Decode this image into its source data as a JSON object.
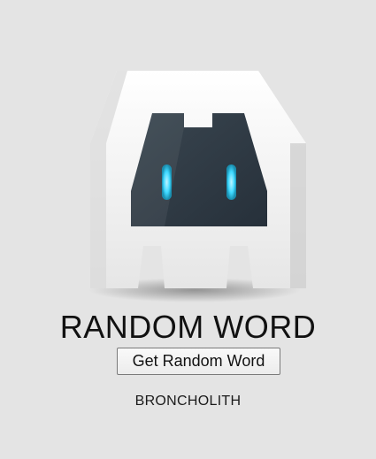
{
  "logo": {
    "icon": "cordova-robot-logo",
    "body_color": "#f2f2f2",
    "shade_color": "#d6d6d6",
    "screen_color": "#2f3a44",
    "eye_color": "#3fd9ff"
  },
  "app": {
    "title": "RANDOM WORD"
  },
  "button": {
    "label": "Get Random Word"
  },
  "result": {
    "word": "BRONCHOLITH"
  }
}
